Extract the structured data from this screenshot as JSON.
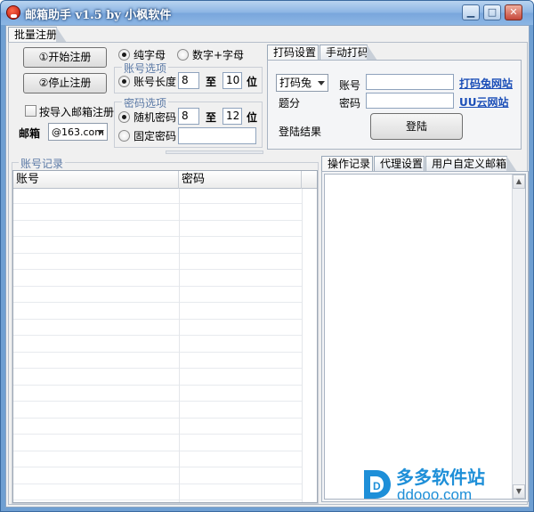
{
  "window": {
    "title": "邮箱助手 v1.5 by 小枫软件",
    "buttons": {
      "minimize": "▁",
      "maximize": "□",
      "close": "✕"
    }
  },
  "main_tab": "批量注册",
  "controls": {
    "start_button": "①开始注册",
    "stop_button": "②停止注册",
    "import_checkbox_label": "按导入邮箱注册",
    "mailbox_label": "邮箱",
    "mailbox_value": "@163.com"
  },
  "account_options": {
    "radio_letters": "纯字母",
    "radio_digits_letters": "数字+字母",
    "group_title": "账号选项",
    "length_label": "账号长度",
    "length_min": "8",
    "to_label": "至",
    "length_max": "10",
    "unit_label": "位"
  },
  "password_options": {
    "group_title": "密码选项",
    "random_label": "随机密码",
    "random_min": "8",
    "to_label": "至",
    "random_max": "12",
    "unit_label": "位",
    "fixed_label": "固定密码",
    "fixed_value": ""
  },
  "captcha": {
    "tabs": [
      "打码设置",
      "手动打码"
    ],
    "service_value": "打码兔",
    "score_label": "题分",
    "account_label": "账号",
    "password_label": "密码",
    "login_result_label": "登陆结果",
    "login_button": "登陆",
    "link_dama": "打码兔网站",
    "link_uu": "UU云网站"
  },
  "records": {
    "group_title": "账号记录",
    "columns": [
      "账号",
      "密码"
    ],
    "row_count": 19
  },
  "log_tabs": [
    "操作记录",
    "代理设置",
    "用户自定义邮箱"
  ],
  "watermark": {
    "text_cn": "多多软件站",
    "text_url": "ddooo.com",
    "logo_letter": "D"
  }
}
